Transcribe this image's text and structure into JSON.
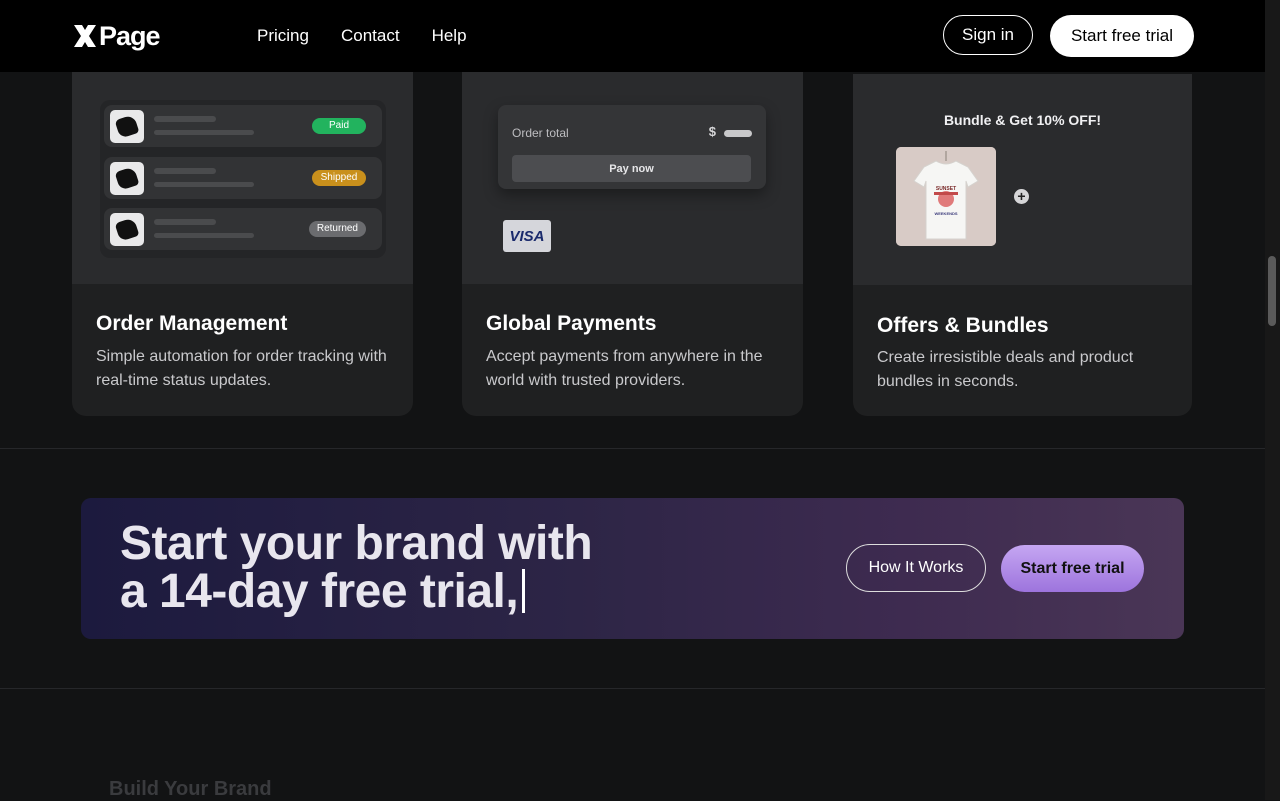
{
  "header": {
    "logo_text": "Page",
    "nav": [
      "Pricing",
      "Contact",
      "Help"
    ],
    "sign_in": "Sign in",
    "start_trial": "Start free trial"
  },
  "cards": [
    {
      "title": "Order Management",
      "description": "Simple automation for order tracking with real-time status updates.",
      "statuses": [
        {
          "label": "Paid",
          "color": "#22b35e"
        },
        {
          "label": "Shipped",
          "color": "#c9901c"
        },
        {
          "label": "Returned",
          "color": "#6b6c6f"
        }
      ]
    },
    {
      "title": "Global Payments",
      "description": "Accept payments from anywhere in the world with trusted providers.",
      "order_total_label": "Order total",
      "currency": "$",
      "pay_button": "Pay now",
      "card_brand": "VISA"
    },
    {
      "title": "Offers & Bundles",
      "description": "Create irresistible deals and product bundles in seconds.",
      "offer_heading": "Bundle & Get 10% OFF!",
      "plus": "+",
      "shirt_text_top": "SUNSET",
      "shirt_text_bottom": "WEEKENDS"
    }
  ],
  "cta": {
    "heading_line1": "Start your brand with",
    "heading_line2": "a 14-day free trial,",
    "how_it_works": "How It Works",
    "start_trial": "Start free trial"
  },
  "next_section": {
    "title": "Build Your Brand"
  },
  "colors": {
    "background": "#121314",
    "card": "#1f2021",
    "accent": "#b08be8"
  }
}
